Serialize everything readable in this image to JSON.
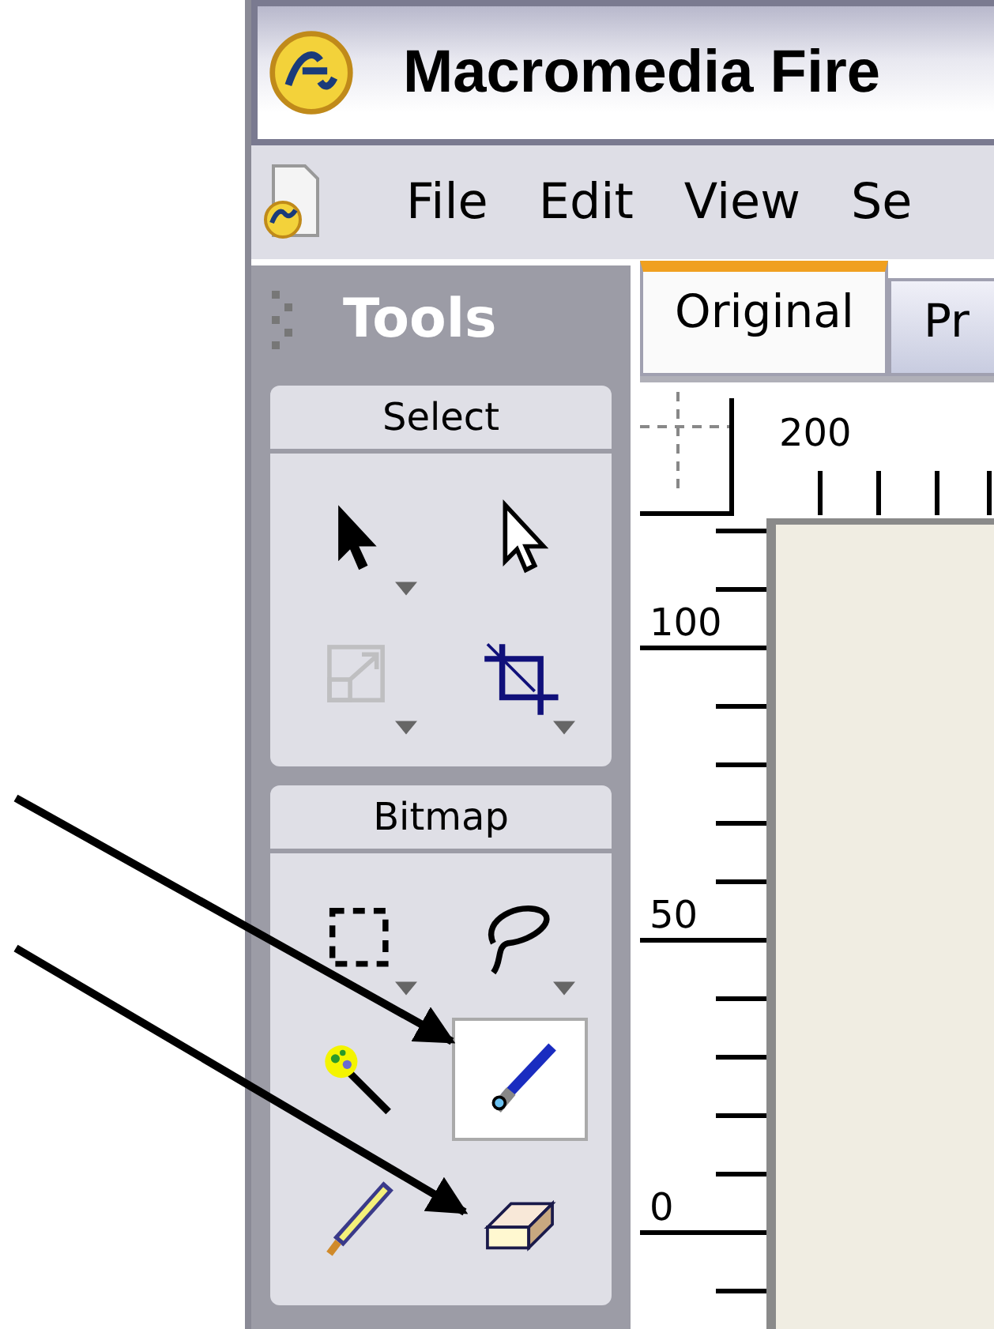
{
  "window": {
    "title": "Macromedia Fire"
  },
  "menu": [
    "File",
    "Edit",
    "View",
    "Se"
  ],
  "tools_panel": {
    "title": "Tools",
    "sections": [
      {
        "label": "Select",
        "tools": [
          {
            "kind": "pointer",
            "selected": false,
            "disabled": false,
            "has_menu": true
          },
          {
            "kind": "subselect",
            "selected": false,
            "disabled": false,
            "has_menu": false
          },
          {
            "kind": "scale",
            "selected": false,
            "disabled": true,
            "has_menu": true
          },
          {
            "kind": "crop",
            "selected": false,
            "disabled": false,
            "has_menu": true
          }
        ]
      },
      {
        "label": "Bitmap",
        "tools": [
          {
            "kind": "marquee",
            "selected": false,
            "disabled": false,
            "has_menu": true
          },
          {
            "kind": "lasso",
            "selected": false,
            "disabled": false,
            "has_menu": true
          },
          {
            "kind": "magic-wand",
            "selected": false,
            "disabled": false,
            "has_menu": false
          },
          {
            "kind": "brush",
            "selected": true,
            "disabled": false,
            "has_menu": false
          },
          {
            "kind": "pencil",
            "selected": false,
            "disabled": false,
            "has_menu": false
          },
          {
            "kind": "eraser",
            "selected": false,
            "disabled": false,
            "has_menu": false
          }
        ]
      }
    ]
  },
  "document_tabs": [
    {
      "label": "Original",
      "selected": true
    },
    {
      "label": "Pr",
      "selected": false
    }
  ],
  "rulers": {
    "top_labels": [
      "200"
    ],
    "left_labels": [
      "100",
      "50",
      "0"
    ]
  }
}
